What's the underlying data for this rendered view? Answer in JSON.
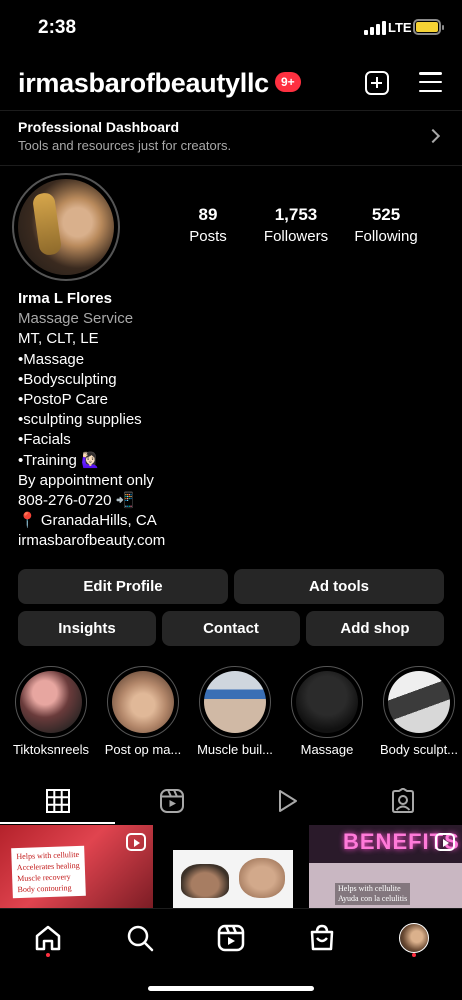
{
  "status_bar": {
    "time": "2:38",
    "network": "LTE"
  },
  "header": {
    "username": "irmasbarofbeautyllc",
    "notification_badge": "9+"
  },
  "dashboard": {
    "title": "Professional Dashboard",
    "subtitle": "Tools and resources just for creators."
  },
  "stats": [
    {
      "value": "89",
      "label": "Posts"
    },
    {
      "value": "1,753",
      "label": "Followers"
    },
    {
      "value": "525",
      "label": "Following"
    }
  ],
  "bio": {
    "name": "Irma L Flores",
    "category": "Massage Service",
    "lines": [
      "MT, CLT, LE",
      "•Massage",
      "•Bodysculpting",
      "•PostoP Care",
      "•sculpting supplies",
      "•Facials",
      "•Training 🙋🏻‍♀️",
      "By appointment only",
      "808-276-0720 📲",
      "📍 GranadaHills, CA"
    ],
    "link": "irmasbarofbeauty.com"
  },
  "buttons": {
    "edit_profile": "Edit Profile",
    "ad_tools": "Ad tools",
    "insights": "Insights",
    "contact": "Contact",
    "add_shop": "Add shop"
  },
  "highlights": [
    {
      "label": "Tiktoksnreels"
    },
    {
      "label": "Post op ma..."
    },
    {
      "label": "Muscle buil..."
    },
    {
      "label": "Massage"
    },
    {
      "label": "Body sculpt..."
    }
  ],
  "grid_posts": [
    {
      "caption": [
        "Helps with cellulite",
        "Accelerates healing",
        "Muscle recovery",
        "Body contouring"
      ]
    },
    {
      "caption": []
    },
    {
      "overlay": "BENEFITS",
      "caption": [
        "Helps with cellulite",
        "Ayuda con la celulitis"
      ]
    }
  ],
  "colors": {
    "accent_red": "#ff3040",
    "button_bg": "#262626",
    "secondary_text": "#a8a8a8"
  }
}
